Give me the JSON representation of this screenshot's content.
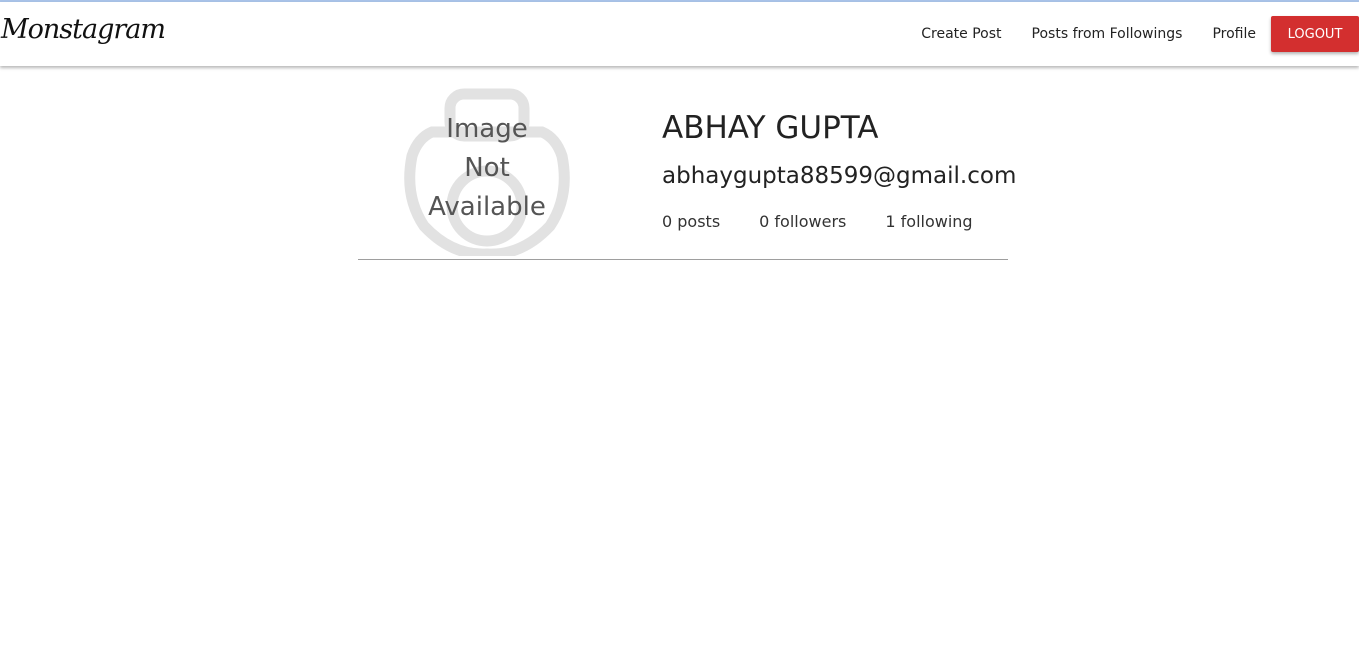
{
  "navbar": {
    "brand": "Monstagram",
    "links": [
      "Create Post",
      "Posts from Followings",
      "Profile"
    ],
    "logout_label": "LOGOUT",
    "logout_color": "#d32f2f"
  },
  "profile": {
    "avatar_text_lines": [
      "Image",
      "Not",
      "Available"
    ],
    "name": "ABHAY GUPTA",
    "email": "abhaygupta88599@gmail.com",
    "stats": {
      "posts": "0 posts",
      "followers": "0 followers",
      "following": "1 following"
    }
  }
}
